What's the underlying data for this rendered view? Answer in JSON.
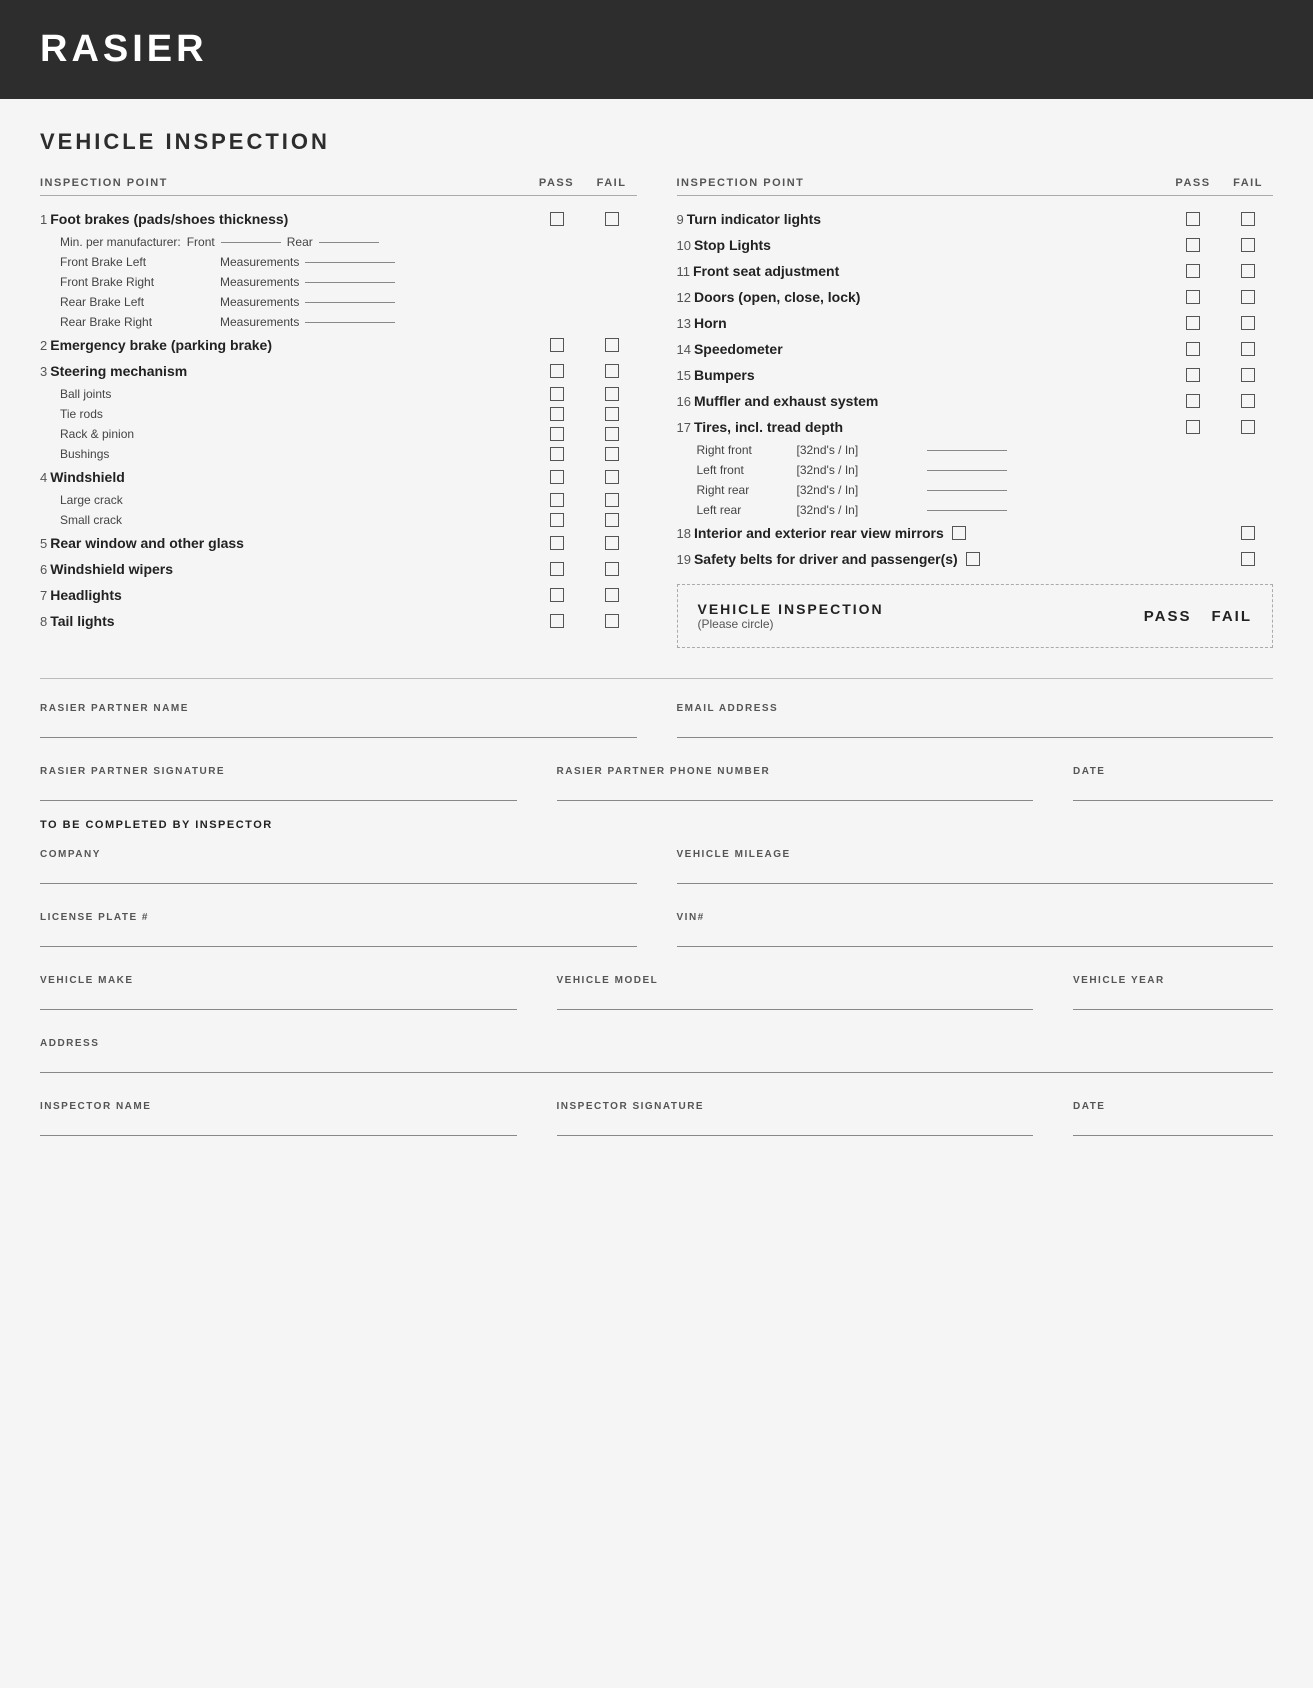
{
  "header": {
    "title": "RASIER"
  },
  "section_title": "VEHICLE INSPECTION",
  "col_headers": {
    "inspection_point": "INSPECTION POINT",
    "pass": "PASS",
    "fail": "FAIL"
  },
  "left_items": [
    {
      "number": "1",
      "label": "Foot brakes (pads/shoes thickness)",
      "bold": true,
      "has_checkbox": true,
      "sub_items": [
        {
          "type": "min_per",
          "label": "Min. per manufacturer:",
          "front_label": "Front",
          "rear_label": "Rear"
        },
        {
          "type": "measurement",
          "label": "Front Brake Left",
          "meas_label": "Measurements"
        },
        {
          "type": "measurement",
          "label": "Front Brake Right",
          "meas_label": "Measurements"
        },
        {
          "type": "measurement",
          "label": "Rear Brake Left",
          "meas_label": "Measurements"
        },
        {
          "type": "measurement",
          "label": "Rear Brake Right",
          "meas_label": "Measurements"
        }
      ]
    },
    {
      "number": "2",
      "label": "Emergency brake (parking brake)",
      "bold": true,
      "has_checkbox": true
    },
    {
      "number": "3",
      "label": "Steering mechanism",
      "bold": true,
      "has_checkbox": true,
      "sub_items": [
        {
          "type": "checkbox_sub",
          "label": "Ball joints"
        },
        {
          "type": "checkbox_sub",
          "label": "Tie rods"
        },
        {
          "type": "checkbox_sub",
          "label": "Rack & pinion"
        },
        {
          "type": "checkbox_sub",
          "label": "Bushings"
        }
      ]
    },
    {
      "number": "4",
      "label": "Windshield",
      "bold": true,
      "has_checkbox": true,
      "sub_items": [
        {
          "type": "checkbox_sub",
          "label": "Large crack"
        },
        {
          "type": "checkbox_sub",
          "label": "Small crack"
        }
      ]
    },
    {
      "number": "5",
      "label": "Rear window and other glass",
      "bold": true,
      "has_checkbox": true
    },
    {
      "number": "6",
      "label": "Windshield wipers",
      "bold": true,
      "has_checkbox": true
    },
    {
      "number": "7",
      "label": "Headlights",
      "bold": true,
      "has_checkbox": true
    },
    {
      "number": "8",
      "label": "Tail lights",
      "bold": true,
      "has_checkbox": true
    }
  ],
  "right_items": [
    {
      "number": "9",
      "label": "Turn indicator lights",
      "bold": true,
      "has_checkbox": true
    },
    {
      "number": "10",
      "label": "Stop Lights",
      "bold": true,
      "has_checkbox": true
    },
    {
      "number": "11",
      "label": "Front seat adjustment",
      "bold": true,
      "has_checkbox": true
    },
    {
      "number": "12",
      "label": "Doors (open, close, lock)",
      "bold": true,
      "has_checkbox": true
    },
    {
      "number": "13",
      "label": "Horn",
      "bold": true,
      "has_checkbox": true
    },
    {
      "number": "14",
      "label": "Speedometer",
      "bold": true,
      "has_checkbox": true
    },
    {
      "number": "15",
      "label": "Bumpers",
      "bold": true,
      "has_checkbox": true
    },
    {
      "number": "16",
      "label": "Muffler and exhaust system",
      "bold": true,
      "has_checkbox": true
    },
    {
      "number": "17",
      "label": "Tires, incl. tread depth",
      "bold": true,
      "has_checkbox": true,
      "sub_items": [
        {
          "type": "tire",
          "label": "Right front",
          "unit": "[32nd's / In]"
        },
        {
          "type": "tire",
          "label": "Left front",
          "unit": "[32nd's / In]"
        },
        {
          "type": "tire",
          "label": "Right rear",
          "unit": "[32nd's / In]"
        },
        {
          "type": "tire",
          "label": "Left rear",
          "unit": "[32nd's / In]"
        }
      ]
    },
    {
      "number": "18",
      "label": "Interior and exterior rear view mirrors",
      "bold": true,
      "has_checkbox": true
    },
    {
      "number": "19",
      "label": "Safety belts for driver and passenger(s)",
      "bold": true,
      "has_checkbox": true
    }
  ],
  "dashed_section": {
    "label": "VEHICLE INSPECTION",
    "sub_label": "(Please circle)",
    "pass_label": "PASS",
    "fail_label": "FAIL"
  },
  "form_fields": {
    "partner_name_label": "RASIER PARTNER NAME",
    "email_label": "EMAIL ADDRESS",
    "signature_label": "RASIER PARTNER SIGNATURE",
    "phone_label": "RASIER PARTNER PHONE NUMBER",
    "date_label": "DATE",
    "inspector_section_label": "TO BE COMPLETED BY INSPECTOR",
    "company_label": "COMPANY",
    "mileage_label": "VEHICLE MILEAGE",
    "license_label": "LICENSE PLATE #",
    "vin_label": "VIN#",
    "make_label": "VEHICLE MAKE",
    "model_label": "VEHICLE MODEL",
    "year_label": "VEHICLE YEAR",
    "address_label": "ADDRESS",
    "inspector_name_label": "INSPECTOR NAME",
    "inspector_sig_label": "INSPECTOR SIGNATURE",
    "inspector_date_label": "DATE"
  }
}
